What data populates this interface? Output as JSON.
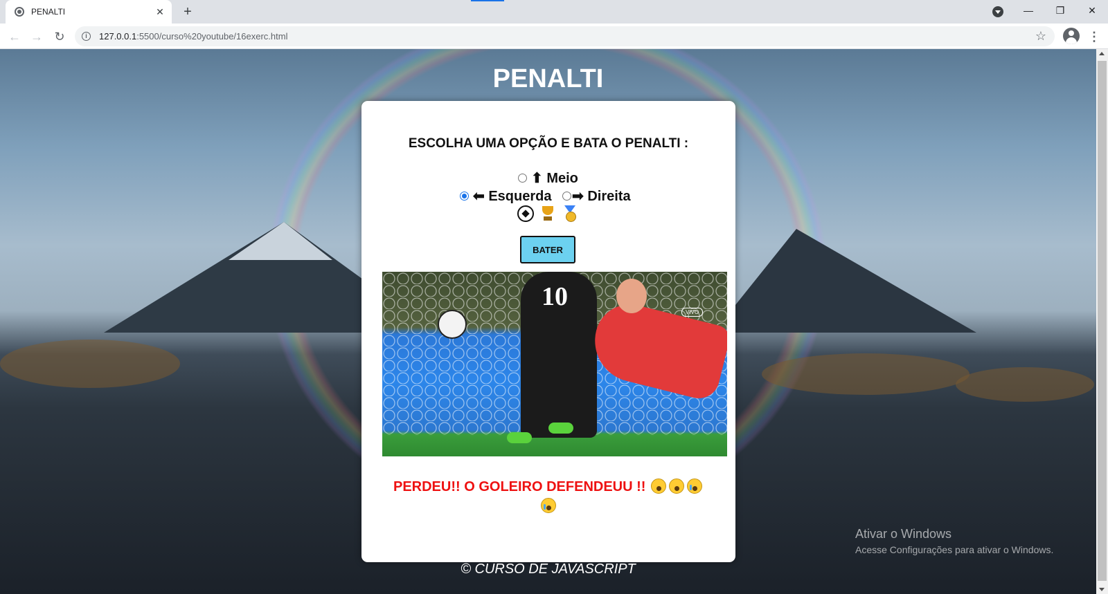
{
  "browser": {
    "tab_title": "PENALTI",
    "tab_close": "✕",
    "new_tab": "+",
    "url_host": "127.0.0.1",
    "url_rest": ":5500/curso%20youtube/16exerc.html",
    "window_buttons": {
      "minimize": "—",
      "restore": "❐",
      "close": "✕"
    }
  },
  "page": {
    "title": "PENALTI",
    "prompt": "ESCOLHA UMA OPÇÃO E BATA O PENALTI :",
    "options": {
      "meio": {
        "label": "⬆ Meio",
        "checked": false
      },
      "esquerda": {
        "label": "⬅ Esquerda",
        "checked": true
      },
      "direita": {
        "label": "➡ Direita",
        "checked": false
      }
    },
    "emojis": [
      "soccer-ball-icon",
      "trophy-icon",
      "medal-icon"
    ],
    "button_label": "BATER",
    "photo": {
      "player_number": "10",
      "live_badge": "VIVO"
    },
    "result_text": "PERDEU!! O GOLEIRO DEFENDEUU !!",
    "result_emojis": [
      "scream-icon",
      "scream-icon",
      "crying-icon",
      "crying-icon"
    ],
    "result_color": "#ee1111",
    "footer": "© CURSO DE JAVASCRIPT"
  },
  "windows_activation": {
    "title": "Ativar o Windows",
    "subtitle": "Acesse Configurações para ativar o Windows."
  },
  "colors": {
    "button_bg": "#6cd1f0",
    "radio_checked": "#1a73e8"
  }
}
